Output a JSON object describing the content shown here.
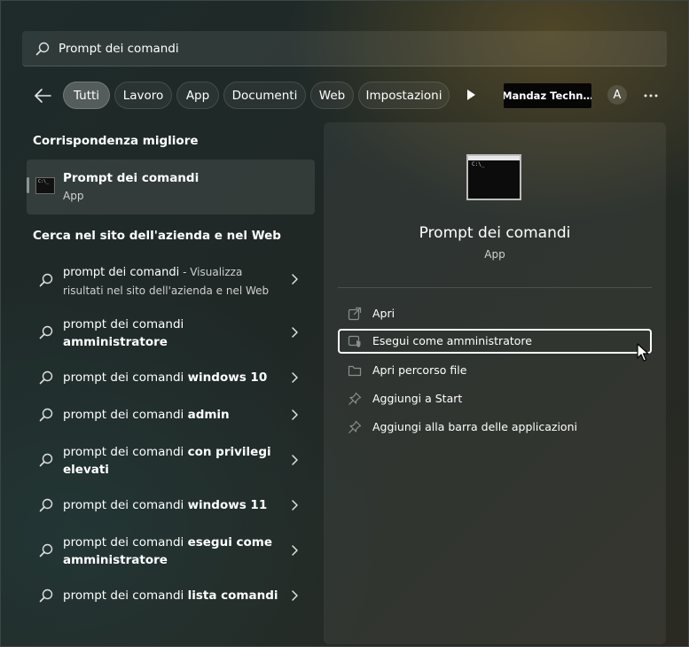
{
  "search": {
    "query": "Prompt dei comandi",
    "icon": "search-icon"
  },
  "filters": {
    "tabs": [
      {
        "label": "Tutti",
        "active": true
      },
      {
        "label": "Lavoro",
        "active": false
      },
      {
        "label": "App",
        "active": false
      },
      {
        "label": "Documenti",
        "active": false
      },
      {
        "label": "Web",
        "active": false
      },
      {
        "label": "Impostazioni",
        "active": false
      }
    ],
    "account_badge": "Mandaz Techn…",
    "avatar_letter": "A"
  },
  "best_match": {
    "section_title": "Corrispondenza migliore",
    "name": "Prompt dei comandi",
    "type": "App"
  },
  "web_section": {
    "title": "Cerca nel sito dell'azienda e nel Web",
    "items": [
      {
        "plain": "prompt dei comandi",
        "bold": "",
        "suffix": " - Visualizza risultati nel sito dell'azienda e nel Web"
      },
      {
        "plain": "prompt dei comandi ",
        "bold": "amministratore",
        "suffix": ""
      },
      {
        "plain": "prompt dei comandi ",
        "bold": "windows 10",
        "suffix": ""
      },
      {
        "plain": "prompt dei comandi ",
        "bold": "admin",
        "suffix": ""
      },
      {
        "plain": "prompt dei comandi ",
        "bold": "con privilegi elevati",
        "suffix": ""
      },
      {
        "plain": "prompt dei comandi ",
        "bold": "windows 11",
        "suffix": ""
      },
      {
        "plain": "prompt dei comandi ",
        "bold": "esegui come amministratore",
        "suffix": ""
      },
      {
        "plain": "prompt dei comandi ",
        "bold": "lista comandi",
        "suffix": ""
      }
    ]
  },
  "details": {
    "title": "Prompt dei comandi",
    "type": "App",
    "actions": [
      {
        "label": "Apri",
        "icon": "open-external-icon"
      },
      {
        "label": "Esegui come amministratore",
        "icon": "run-as-admin-icon",
        "focused": true
      },
      {
        "label": "Apri percorso file",
        "icon": "folder-icon"
      },
      {
        "label": "Aggiungi a Start",
        "icon": "pin-icon"
      },
      {
        "label": "Aggiungi alla barra delle applicazioni",
        "icon": "pin-icon"
      }
    ]
  },
  "colors": {
    "accent_text": "#ffffff",
    "focus_ring": "#ffffff"
  }
}
